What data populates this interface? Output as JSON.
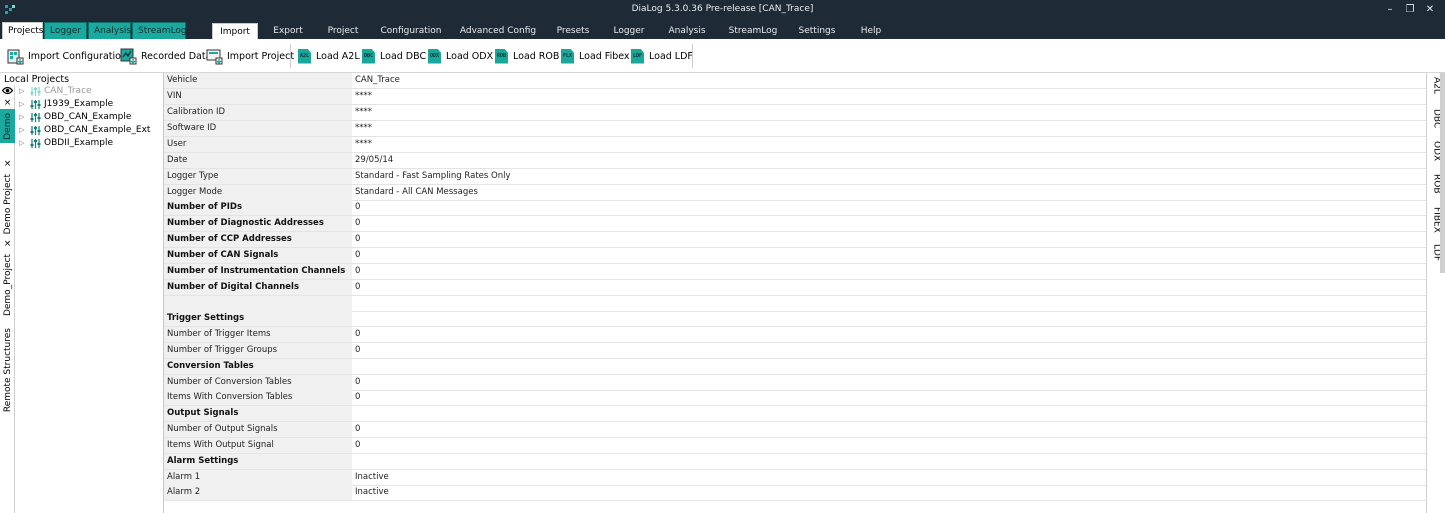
{
  "window": {
    "title": "DiaLog 5.3.0.36 Pre-release  [CAN_Trace]",
    "minimize": "–",
    "restore": "❐",
    "close": "✕"
  },
  "left_tabs": [
    "Projects",
    "Logger",
    "Analysis",
    "StreamLog"
  ],
  "menu_tabs": [
    "Import",
    "Export",
    "Project",
    "Configuration",
    "Advanced Config",
    "Presets",
    "Logger",
    "Analysis",
    "StreamLog",
    "Settings",
    "Help"
  ],
  "ribbon": {
    "import_configuration": "Import Configuration",
    "recorded_data": "Recorded Data",
    "import_project": "Import Project",
    "loaders": [
      {
        "icon": "A2L",
        "label": "Load A2L"
      },
      {
        "icon": "DBC",
        "label": "Load DBC"
      },
      {
        "icon": "ODX",
        "label": "Load ODX"
      },
      {
        "icon": "ROB",
        "label": "Load ROB"
      },
      {
        "icon": "FLX",
        "label": "Load Fibex"
      },
      {
        "icon": "LDF",
        "label": "Load LDF"
      }
    ]
  },
  "left_panel": {
    "header": "Local Projects",
    "vertical_tabs": [
      "Demo",
      "Demo Project",
      "Demo_Project",
      "Remote Structures"
    ],
    "close_glyph": "×",
    "tree": [
      "CAN_Trace",
      "J1939_Example",
      "OBD_CAN_Example",
      "OBD_CAN_Example_Ext",
      "OBDII_Example"
    ]
  },
  "properties": [
    {
      "key": "Vehicle",
      "value": "CAN_Trace",
      "bold": false
    },
    {
      "key": "VIN",
      "value": "****",
      "bold": false
    },
    {
      "key": "Calibration ID",
      "value": "****",
      "bold": false
    },
    {
      "key": "Software ID",
      "value": "****",
      "bold": false
    },
    {
      "key": "User",
      "value": "****",
      "bold": false
    },
    {
      "key": "Date",
      "value": "29/05/14",
      "bold": false
    },
    {
      "key": "Logger Type",
      "value": "Standard - Fast Sampling Rates Only",
      "bold": false
    },
    {
      "key": "Logger Mode",
      "value": "Standard - All CAN Messages",
      "bold": false
    },
    {
      "key": "Number of PIDs",
      "value": "0",
      "bold": true
    },
    {
      "key": "Number of Diagnostic Addresses",
      "value": "0",
      "bold": true
    },
    {
      "key": "Number of CCP Addresses",
      "value": "0",
      "bold": true
    },
    {
      "key": "Number of CAN Signals",
      "value": "0",
      "bold": true
    },
    {
      "key": "Number of Instrumentation Channels",
      "value": "0",
      "bold": true
    },
    {
      "key": "Number of Digital Channels",
      "value": "0",
      "bold": true
    },
    {
      "key": "",
      "value": "",
      "bold": false
    },
    {
      "key": "",
      "value": "",
      "bold": false
    },
    {
      "key": "Trigger Settings",
      "value": "",
      "bold": true
    },
    {
      "key": "Number of Trigger Items",
      "value": "0",
      "bold": false
    },
    {
      "key": "Number of Trigger Groups",
      "value": "0",
      "bold": false
    },
    {
      "key": "Conversion Tables",
      "value": "",
      "bold": true
    },
    {
      "key": "Number of Conversion Tables",
      "value": "0",
      "bold": false
    },
    {
      "key": "Items With Conversion Tables",
      "value": "0",
      "bold": false
    },
    {
      "key": "Output Signals",
      "value": "",
      "bold": true
    },
    {
      "key": "Number of Output Signals",
      "value": "0",
      "bold": false
    },
    {
      "key": "Items With Output Signal",
      "value": "0",
      "bold": false
    },
    {
      "key": "Alarm Settings",
      "value": "",
      "bold": true
    },
    {
      "key": "Alarm 1",
      "value": "Inactive",
      "bold": false
    },
    {
      "key": "Alarm 2",
      "value": "Inactive",
      "bold": false
    }
  ],
  "right_tabs": [
    "A2L",
    "DBC",
    "ODX",
    "ROB",
    "FIBEX",
    "LDF"
  ],
  "colors": {
    "accent": "#1aa99e",
    "titlebar": "#1e2b36"
  }
}
